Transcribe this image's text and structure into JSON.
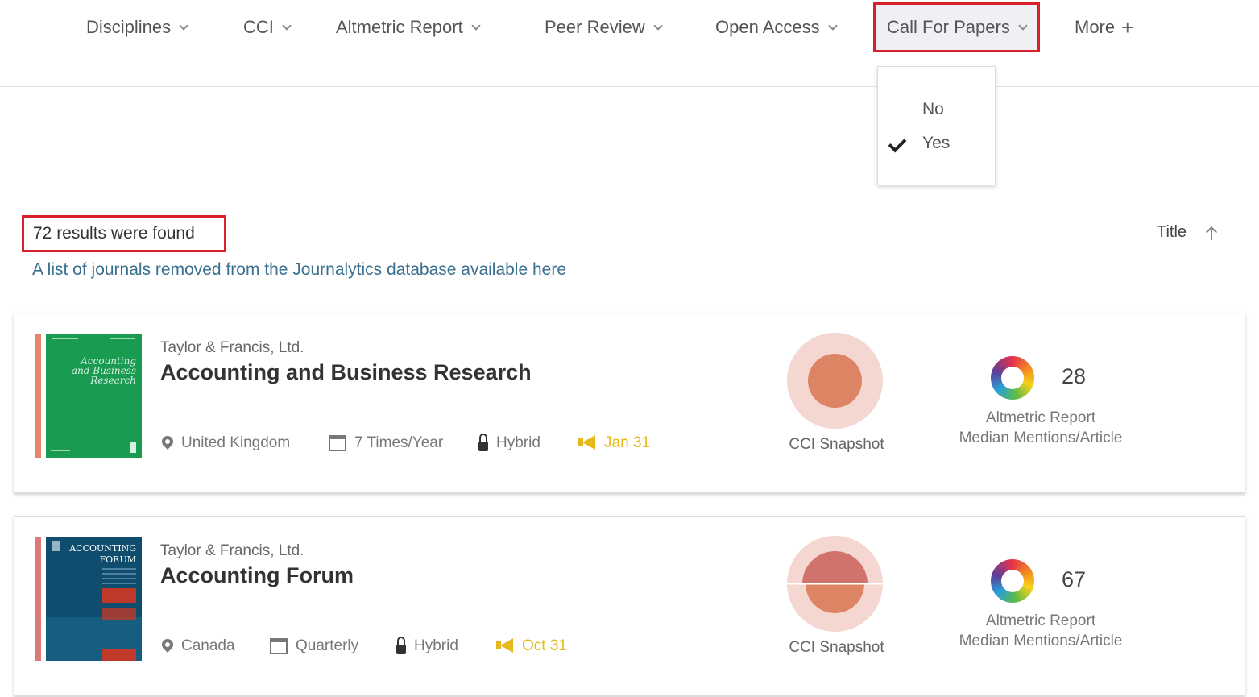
{
  "nav": {
    "items": [
      {
        "label": "Disciplines",
        "suffix": "chevron"
      },
      {
        "label": "CCI",
        "suffix": "chevron"
      },
      {
        "label": "Altmetric Report",
        "suffix": "chevron"
      },
      {
        "label": "Peer Review",
        "suffix": "chevron"
      },
      {
        "label": "Open Access",
        "suffix": "chevron"
      },
      {
        "label": "Call For Papers",
        "suffix": "chevron",
        "active": true
      },
      {
        "label": "More",
        "suffix": "plus"
      }
    ],
    "dropdown": {
      "options": [
        {
          "label": "No",
          "selected": false
        },
        {
          "label": "Yes",
          "selected": true
        }
      ]
    }
  },
  "results": {
    "count_text": "72 results were found",
    "removed_link": "A list of journals removed from the Journalytics database available here",
    "sort_label": "Title"
  },
  "journals": [
    {
      "publisher": "Taylor & Francis, Ltd.",
      "title": "Accounting and Business Research",
      "country": "United Kingdom",
      "frequency": "7 Times/Year",
      "access": "Hybrid",
      "cfp_date": "Jan 31",
      "cci_label": "CCI Snapshot",
      "altmetric_value": "28",
      "altmetric_label_1": "Altmetric Report",
      "altmetric_label_2": "Median Mentions/Article",
      "stripe_color": "#e2876d",
      "cover_color": "#1a9b52",
      "cover_text": "Accounting and Business Research"
    },
    {
      "publisher": "Taylor & Francis, Ltd.",
      "title": "Accounting Forum",
      "country": "Canada",
      "frequency": "Quarterly",
      "access": "Hybrid",
      "cfp_date": "Oct 31",
      "cci_label": "CCI Snapshot",
      "altmetric_value": "67",
      "altmetric_label_1": "Altmetric Report",
      "altmetric_label_2": "Median Mentions/Article",
      "stripe_color": "#db7a78",
      "cover_color": "#0f4c6e",
      "cover_text": "ACCOUNTING FORUM"
    }
  ],
  "colors": {
    "highlight": "#d9202a",
    "link": "#3a6f8f",
    "cfp": "#e5b91a",
    "cci_ring": "#f4d7d0",
    "cci_core": "#dc8463"
  }
}
